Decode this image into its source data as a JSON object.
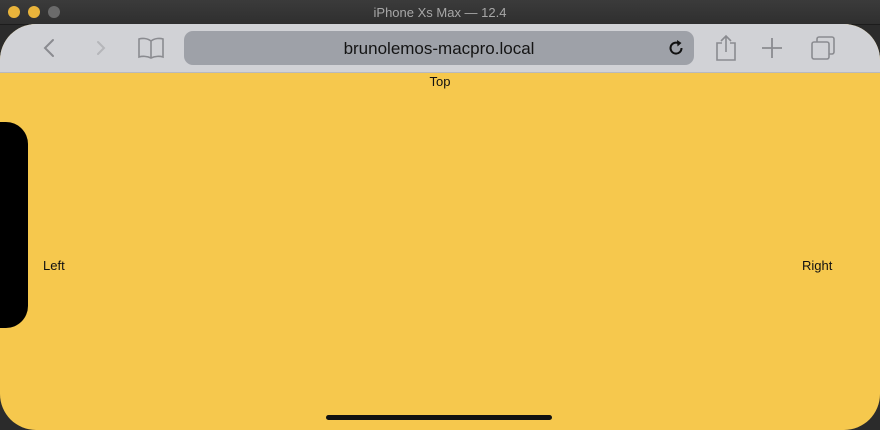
{
  "window": {
    "title": "iPhone Xs Max — 12.4"
  },
  "browser": {
    "url": "brunolemos-macpro.local",
    "icons": [
      "back-icon",
      "forward-icon",
      "bookmarks-icon",
      "reload-icon",
      "share-icon",
      "new-tab-icon",
      "tabs-icon"
    ]
  },
  "page": {
    "background_color": "#f6c84d",
    "top_label": "Top",
    "left_label": "Left",
    "right_label": "Right"
  }
}
